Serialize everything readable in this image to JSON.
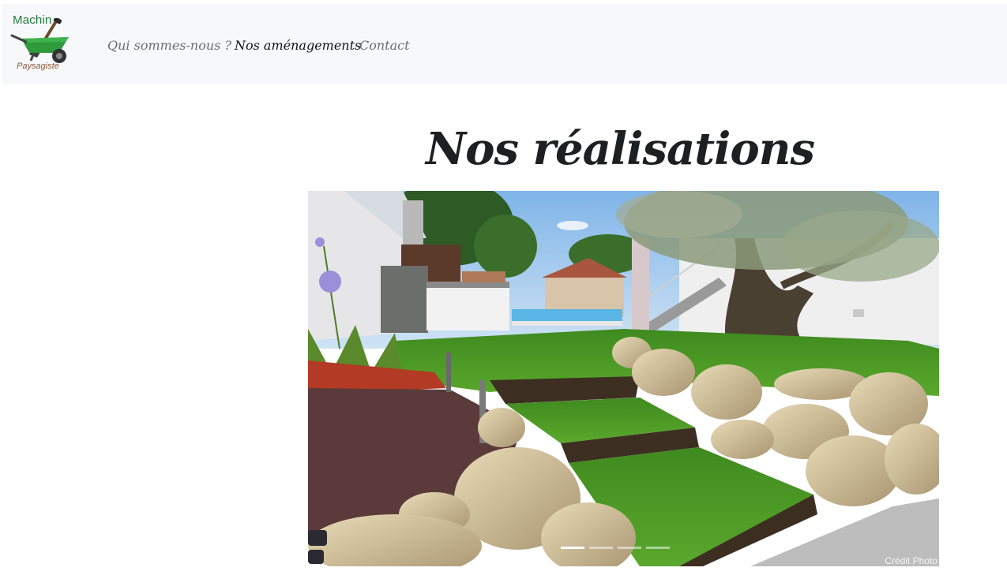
{
  "brand": {
    "name_top": "Machin",
    "name_bottom": "Paysagiste"
  },
  "nav": {
    "items": [
      {
        "label": "Qui sommes-nous ?",
        "active": false
      },
      {
        "label": "Nos aménagements",
        "active": true
      },
      {
        "label": "Contact",
        "active": false
      }
    ]
  },
  "page": {
    "title": "Nos réalisations"
  },
  "carousel": {
    "image_credit": "Crédit Photo",
    "slide_count": 4,
    "active_slide": 1
  },
  "colors": {
    "navbar_bg": "#f7f8fa",
    "nav_active": "#111111",
    "nav_inactive": "#6d6d6d",
    "brand_green": "#1f7a3a"
  }
}
